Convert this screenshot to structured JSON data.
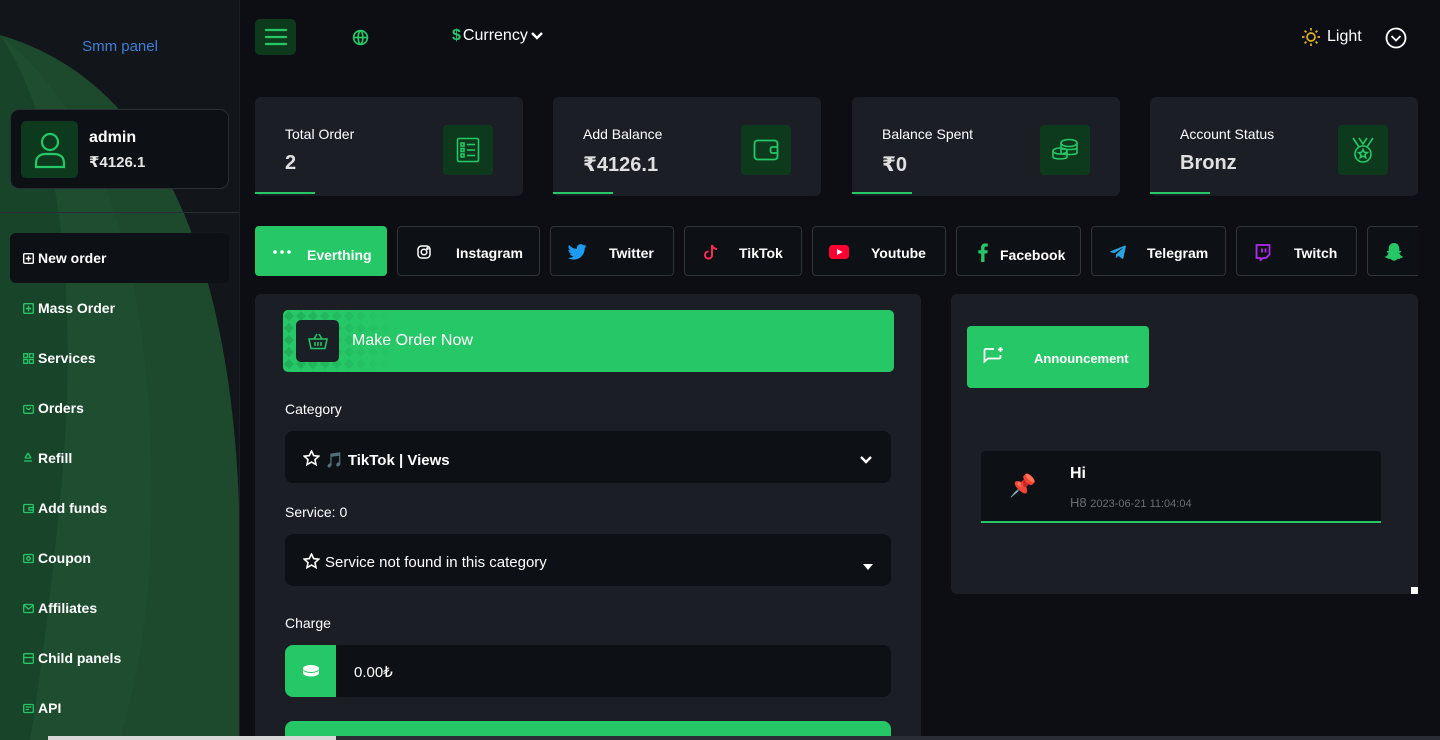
{
  "sidebar": {
    "brand": "Smm panel",
    "user": {
      "name": "admin",
      "balance": "₹4126.1"
    },
    "items": [
      {
        "label": "New order",
        "active": true
      },
      {
        "label": "Mass Order"
      },
      {
        "label": "Services"
      },
      {
        "label": "Orders"
      },
      {
        "label": "Refill"
      },
      {
        "label": "Add funds"
      },
      {
        "label": "Coupon"
      },
      {
        "label": "Affiliates"
      },
      {
        "label": "Child panels"
      },
      {
        "label": "API"
      }
    ]
  },
  "header": {
    "currency_symbol": "$",
    "currency_label": "Currency",
    "theme_label": "Light"
  },
  "stats": [
    {
      "label": "Total Order",
      "value": "2",
      "icon": "list-icon"
    },
    {
      "label": "Add Balance",
      "value": "₹4126.1",
      "icon": "wallet-icon"
    },
    {
      "label": "Balance Spent",
      "value": "₹0",
      "icon": "coins-icon"
    },
    {
      "label": "Account Status",
      "value": "Bronz",
      "icon": "medal-icon"
    }
  ],
  "platform_tabs": [
    {
      "label": "Everthing",
      "active": true
    },
    {
      "label": "Instagram"
    },
    {
      "label": "Twitter"
    },
    {
      "label": "TikTok"
    },
    {
      "label": "Youtube"
    },
    {
      "label": "Facebook"
    },
    {
      "label": "Telegram"
    },
    {
      "label": "Twitch"
    },
    {
      "label": ""
    }
  ],
  "order": {
    "make_order_label": "Make Order Now",
    "category_label": "Category",
    "category_value": "TikTok | Views",
    "category_emoji": "🎵",
    "service_label": "Service: 0",
    "service_value": "Service not found in this category",
    "charge_label": "Charge",
    "charge_value": "0.00₺"
  },
  "announcement": {
    "button_label": "Announcement",
    "title": "Hi",
    "body": "H8",
    "timestamp": "2023-06-21 11:04:04"
  },
  "colors": {
    "accent": "#26c767",
    "dark_green": "#0d3a1d",
    "panel": "#1b1e25",
    "background": "#0c0e13"
  }
}
